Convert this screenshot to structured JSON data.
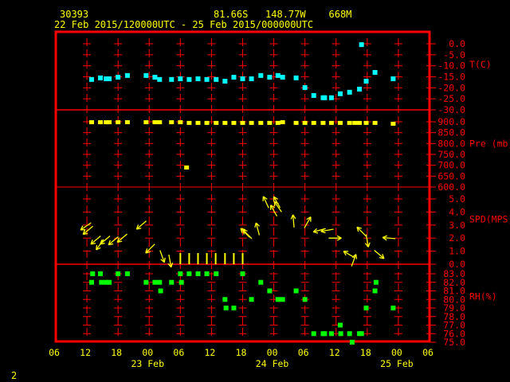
{
  "header": {
    "station": "30393",
    "location": "81.66S   148.77W    668M",
    "period": "22 Feb 2015/120000UTC - 25 Feb 2015/000000UTC"
  },
  "page_number": "2",
  "colors": {
    "frame": "#ff0000",
    "text": "#ffff00",
    "temperature": "#00ffff",
    "pressure": "#ffff00",
    "wind": "#ffff00",
    "rh": "#00ff00"
  },
  "chart_data": {
    "type": "scatter",
    "x_units": "hours since 22 Feb 06 UTC",
    "xlim": [
      0,
      72
    ],
    "grid": true,
    "x_tick_labels": [
      "06",
      "12",
      "18",
      "00",
      "06",
      "12",
      "18",
      "00",
      "06",
      "12",
      "18",
      "00",
      "06"
    ],
    "date_labels": [
      {
        "label": "23 Feb",
        "tick": 3
      },
      {
        "label": "24 Feb",
        "tick": 7
      },
      {
        "label": "25 Feb",
        "tick": 11
      }
    ],
    "panels": [
      {
        "name": "temperature",
        "label": "T(C)",
        "ylim": [
          -30,
          0
        ],
        "tick_labels": [
          "0.0",
          "-5.0",
          "-10.0",
          "-15.0",
          "-20.0",
          "-25.0",
          "-30.0"
        ],
        "ticks": [
          0,
          -5,
          -10,
          -15,
          -20,
          -25,
          -30
        ],
        "points": [
          [
            6.9,
            -16.2
          ],
          [
            8.6,
            -15.5
          ],
          [
            9.7,
            -15.9
          ],
          [
            10.3,
            -15.9
          ],
          [
            12,
            -15.2
          ],
          [
            13.8,
            -14.4
          ],
          [
            17.4,
            -14.4
          ],
          [
            19.1,
            -15.2
          ],
          [
            20,
            -16.2
          ],
          [
            22.3,
            -16.2
          ],
          [
            24,
            -15.9
          ],
          [
            25.7,
            -16.2
          ],
          [
            27.4,
            -15.9
          ],
          [
            29.1,
            -16.2
          ],
          [
            30.9,
            -16.2
          ],
          [
            32.6,
            -17
          ],
          [
            34.3,
            -15.2
          ],
          [
            36,
            -15.9
          ],
          [
            37.7,
            -15.9
          ],
          [
            39.5,
            -14.4
          ],
          [
            41.2,
            -15.2
          ],
          [
            42.8,
            -14.4
          ],
          [
            43.7,
            -15.2
          ],
          [
            46.3,
            -15.5
          ],
          [
            48,
            -19.9
          ],
          [
            49.7,
            -23.5
          ],
          [
            51.5,
            -24.5
          ],
          [
            51.8,
            -24.5
          ],
          [
            53.1,
            -24.5
          ],
          [
            54.8,
            -22.7
          ],
          [
            56.6,
            -22
          ],
          [
            58.5,
            -20.6
          ],
          [
            58.9,
            -0.4
          ],
          [
            59.8,
            -17
          ],
          [
            61.5,
            -13
          ],
          [
            65,
            -15.9
          ]
        ]
      },
      {
        "name": "pressure",
        "label": "Pre (mb)",
        "ylim": [
          600,
          900
        ],
        "tick_labels": [
          "900.0",
          "850.0",
          "800.0",
          "750.0",
          "700.0",
          "650.0",
          "600.0"
        ],
        "ticks": [
          900,
          850,
          800,
          750,
          700,
          650,
          600
        ],
        "points": [
          [
            6.9,
            896
          ],
          [
            8.6,
            896
          ],
          [
            9.7,
            896
          ],
          [
            10.3,
            896
          ],
          [
            12,
            896
          ],
          [
            13.8,
            896
          ],
          [
            17.4,
            896
          ],
          [
            19.1,
            896
          ],
          [
            20,
            896
          ],
          [
            22.3,
            896
          ],
          [
            24,
            896
          ],
          [
            25.7,
            893
          ],
          [
            27.4,
            893
          ],
          [
            29.1,
            893
          ],
          [
            30.9,
            893
          ],
          [
            32.6,
            893
          ],
          [
            34.3,
            893
          ],
          [
            36,
            893
          ],
          [
            37.7,
            893
          ],
          [
            39.5,
            893
          ],
          [
            41.2,
            893
          ],
          [
            42.8,
            893
          ],
          [
            43.7,
            896
          ],
          [
            46.3,
            893
          ],
          [
            48,
            893
          ],
          [
            49.7,
            893
          ],
          [
            51.5,
            893
          ],
          [
            53.1,
            893
          ],
          [
            54.8,
            893
          ],
          [
            56.6,
            893
          ],
          [
            57.6,
            893
          ],
          [
            58.5,
            893
          ],
          [
            59.8,
            893
          ],
          [
            61.5,
            893
          ],
          [
            65,
            889
          ],
          [
            25.2,
            688
          ]
        ]
      },
      {
        "name": "wind_speed",
        "label": "SPD(MPS)",
        "ylim": [
          0,
          5.0
        ],
        "tick_labels": [
          "5.0",
          "4.0",
          "3.0",
          "2.0",
          "1.0",
          "0.0"
        ],
        "ticks": [
          5,
          4,
          3,
          2,
          1,
          0
        ],
        "points_hour_speed_pointing_deg": [
          [
            5.8,
            2.9,
            215
          ],
          [
            6.2,
            2.6,
            220
          ],
          [
            7.7,
            1.85,
            220
          ],
          [
            8.5,
            1.5,
            235
          ],
          [
            9.5,
            1.85,
            220
          ],
          [
            11.1,
            1.8,
            220
          ],
          [
            12.8,
            2.0,
            220
          ],
          [
            16.5,
            3.0,
            220
          ],
          [
            18.2,
            1.2,
            225
          ],
          [
            20.5,
            0.6,
            290
          ],
          [
            22,
            0.25,
            280
          ],
          [
            24,
            0,
            270
          ],
          [
            25.7,
            0,
            270
          ],
          [
            27.4,
            0,
            270
          ],
          [
            29.1,
            0,
            270
          ],
          [
            30.8,
            0,
            270
          ],
          [
            32.6,
            0,
            270
          ],
          [
            34.3,
            0,
            270
          ],
          [
            36,
            0,
            270
          ],
          [
            36.5,
            2.4,
            135
          ],
          [
            36.9,
            2.3,
            135
          ],
          [
            38.9,
            2.7,
            105
          ],
          [
            40.5,
            4.75,
            115
          ],
          [
            42,
            4.1,
            120
          ],
          [
            42.6,
            4.75,
            120
          ],
          [
            42.8,
            4.4,
            125
          ],
          [
            45.8,
            3.3,
            95
          ],
          [
            48.5,
            3.2,
            60
          ],
          [
            50.8,
            2.6,
            195
          ],
          [
            52.3,
            2.6,
            190
          ],
          [
            53.8,
            2.0,
            0
          ],
          [
            56.5,
            0.75,
            150
          ],
          [
            57.4,
            0.3,
            70
          ],
          [
            58.9,
            2.5,
            135
          ],
          [
            60,
            1.8,
            280
          ],
          [
            62.3,
            0.75,
            320
          ],
          [
            64.2,
            2.0,
            175
          ]
        ]
      },
      {
        "name": "relative_humidity",
        "label": "RH(%)",
        "ylim": [
          75,
          83
        ],
        "tick_labels": [
          "83.0",
          "82.0",
          "81.0",
          "80.0",
          "79.0",
          "78.0",
          "77.0",
          "76.0",
          "75.0"
        ],
        "ticks": [
          83,
          82,
          81,
          80,
          79,
          78,
          77,
          76,
          75
        ],
        "points": [
          [
            7.1,
            83
          ],
          [
            8.6,
            83
          ],
          [
            12,
            83
          ],
          [
            13.8,
            83
          ],
          [
            24,
            83
          ],
          [
            25.7,
            83
          ],
          [
            27.4,
            83
          ],
          [
            29.1,
            83
          ],
          [
            30.9,
            83
          ],
          [
            36,
            83
          ],
          [
            6.9,
            82
          ],
          [
            8.8,
            82
          ],
          [
            9.7,
            82
          ],
          [
            10.3,
            82
          ],
          [
            17.4,
            82
          ],
          [
            19.1,
            82
          ],
          [
            20,
            82
          ],
          [
            22.3,
            82
          ],
          [
            24.2,
            82
          ],
          [
            20.2,
            81
          ],
          [
            32.6,
            80
          ],
          [
            32.8,
            79
          ],
          [
            34.3,
            79
          ],
          [
            39.5,
            82
          ],
          [
            61.7,
            82
          ],
          [
            41.2,
            81
          ],
          [
            46.3,
            81
          ],
          [
            61.5,
            81
          ],
          [
            37.7,
            80
          ],
          [
            42.8,
            80
          ],
          [
            43.7,
            80
          ],
          [
            48,
            80
          ],
          [
            59.8,
            79
          ],
          [
            65,
            79
          ],
          [
            54.8,
            77
          ],
          [
            49.7,
            76
          ],
          [
            51.5,
            76
          ],
          [
            51.8,
            76
          ],
          [
            53.1,
            76
          ],
          [
            54.9,
            76
          ],
          [
            56.6,
            76
          ],
          [
            58.5,
            76
          ],
          [
            58.9,
            76
          ],
          [
            57.1,
            75
          ]
        ]
      }
    ]
  }
}
